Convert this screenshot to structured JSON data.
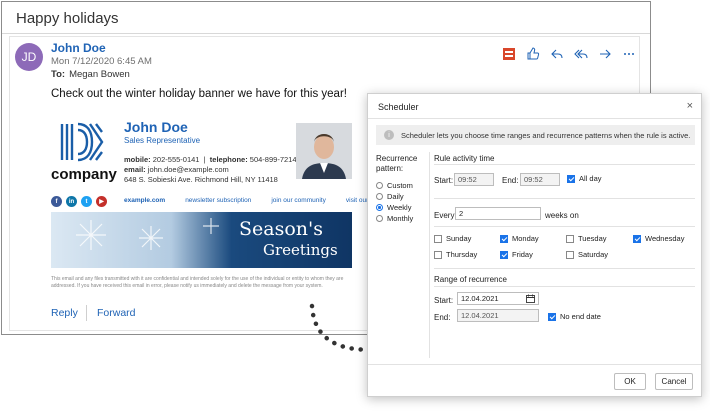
{
  "email": {
    "subject": "Happy holidays",
    "avatar_initials": "JD",
    "sender": "John Doe",
    "date": "Mon 7/12/2020 6:45 AM",
    "to_label": "To:",
    "to_value": "Megan Bowen",
    "body": "Check out the winter holiday banner we have for this year!",
    "toolbar_icons": [
      "office-app-icon",
      "like-icon",
      "reply-icon",
      "reply-all-icon",
      "forward-icon",
      "more-icon"
    ],
    "signature": {
      "company": "company",
      "name": "John Doe",
      "title": "Sales Representative",
      "mobile_label": "mobile:",
      "mobile": "202-555-0141",
      "phone_label": "telephone:",
      "phone": "504-899-7214",
      "email_label": "email:",
      "email": "john.doe@example.com",
      "address": "648 S. Sobieski Ave. Richmond Hill, NY 11418",
      "social": [
        "facebook-icon",
        "linkedin-icon",
        "twitter-icon",
        "youtube-icon"
      ],
      "links": [
        "example.com",
        "newsletter subscription",
        "join our community",
        "visit our store"
      ],
      "banner_line1": "Season's",
      "banner_line2": "Greetings",
      "disclaimer": "This email and any files transmitted with it are confidential and intended solely for the use of the individual or entity to whom they are addressed. If you have received this email in error, please notify us immediately and delete the message from your system."
    },
    "reply": "Reply",
    "forward": "Forward"
  },
  "scheduler": {
    "title": "Scheduler",
    "close": "×",
    "info_icon": "i",
    "info": "Scheduler lets you choose time ranges and recurrence patterns when the rule is active.",
    "recurrence_label": "Recurrence pattern:",
    "patterns": [
      "Custom",
      "Daily",
      "Weekly",
      "Monthly"
    ],
    "selected_pattern": "Weekly",
    "activity_title": "Rule activity time",
    "start_label": "Start:",
    "start_time": "09:52",
    "end_label": "End:",
    "end_time": "09:52",
    "all_day": "All day",
    "every_label": "Every",
    "every_value": "2",
    "weeks_on": "weeks on",
    "days": [
      {
        "label": "Sunday",
        "checked": false
      },
      {
        "label": "Monday",
        "checked": true
      },
      {
        "label": "Tuesday",
        "checked": false
      },
      {
        "label": "Wednesday",
        "checked": true
      },
      {
        "label": "Thursday",
        "checked": false
      },
      {
        "label": "Friday",
        "checked": true
      },
      {
        "label": "Saturday",
        "checked": false
      }
    ],
    "range_title": "Range of recurrence",
    "range_start_label": "Start:",
    "range_start": "12.04.2021",
    "range_end_label": "End:",
    "range_end": "12.04.2021",
    "no_end_date": "No end date",
    "ok": "OK",
    "cancel": "Cancel"
  },
  "colors": {
    "accent": "#1f63b5",
    "avatar": "#8d6ab8",
    "checkbox": "#1a73e8"
  }
}
